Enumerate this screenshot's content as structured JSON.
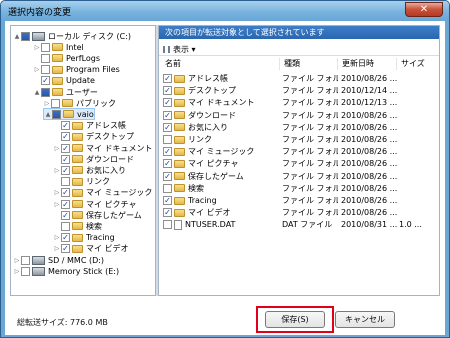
{
  "window": {
    "title": "選択内容の変更",
    "close_label": "✕"
  },
  "tree": {
    "items": [
      {
        "label": "ローカル ディスク (C:)",
        "kind": "drive",
        "checked": "partial",
        "arrow": "▲"
      },
      {
        "label": "Intel",
        "kind": "folder",
        "checked": false,
        "arrow": "▷"
      },
      {
        "label": "PerfLogs",
        "kind": "folder",
        "checked": false,
        "arrow": ""
      },
      {
        "label": "Program Files",
        "kind": "folder",
        "checked": false,
        "arrow": "▷"
      },
      {
        "label": "Update",
        "kind": "folder",
        "checked": true,
        "arrow": ""
      },
      {
        "label": "ユーザー",
        "kind": "folder",
        "checked": "partial",
        "arrow": "▲"
      },
      {
        "label": "パブリック",
        "kind": "folder",
        "checked": false,
        "arrow": "▷"
      },
      {
        "label": "vaio",
        "kind": "folder",
        "checked": "partial",
        "arrow": "▲"
      },
      {
        "label": "アドレス帳",
        "kind": "folder",
        "checked": true,
        "arrow": ""
      },
      {
        "label": "デスクトップ",
        "kind": "folder",
        "checked": true,
        "arrow": ""
      },
      {
        "label": "マイ ドキュメント",
        "kind": "folder",
        "checked": true,
        "arrow": "▷"
      },
      {
        "label": "ダウンロード",
        "kind": "folder",
        "checked": true,
        "arrow": ""
      },
      {
        "label": "お気に入り",
        "kind": "folder",
        "checked": true,
        "arrow": "▷"
      },
      {
        "label": "リンク",
        "kind": "folder",
        "checked": false,
        "arrow": ""
      },
      {
        "label": "マイ ミュージック",
        "kind": "folder",
        "checked": true,
        "arrow": "▷"
      },
      {
        "label": "マイ ピクチャ",
        "kind": "folder",
        "checked": true,
        "arrow": "▷"
      },
      {
        "label": "保存したゲーム",
        "kind": "folder",
        "checked": true,
        "arrow": ""
      },
      {
        "label": "検索",
        "kind": "folder",
        "checked": false,
        "arrow": ""
      },
      {
        "label": "Tracing",
        "kind": "folder",
        "checked": true,
        "arrow": "▷"
      },
      {
        "label": "マイ ビデオ",
        "kind": "folder",
        "checked": true,
        "arrow": "▷"
      },
      {
        "label": "SD / MMC (D:)",
        "kind": "drive",
        "checked": false,
        "arrow": "▷"
      },
      {
        "label": "Memory Stick (E:)",
        "kind": "drive",
        "checked": false,
        "arrow": "▷"
      }
    ]
  },
  "details": {
    "header": "次の項目が転送対象として選択されています",
    "view_label": "表示 ▾",
    "columns": {
      "name": "名前",
      "type": "種類",
      "date": "更新日時",
      "size": "サイズ"
    },
    "rows": [
      {
        "name": "アドレス帳",
        "type": "ファイル フォル...",
        "date": "2010/08/26 ...",
        "size": "",
        "checked": true,
        "icon": "folder"
      },
      {
        "name": "デスクトップ",
        "type": "ファイル フォル...",
        "date": "2010/12/14 ...",
        "size": "",
        "checked": true,
        "icon": "folder"
      },
      {
        "name": "マイ ドキュメント",
        "type": "ファイル フォル...",
        "date": "2010/12/13 ...",
        "size": "",
        "checked": true,
        "icon": "folder"
      },
      {
        "name": "ダウンロード",
        "type": "ファイル フォル...",
        "date": "2010/08/26 ...",
        "size": "",
        "checked": true,
        "icon": "folder"
      },
      {
        "name": "お気に入り",
        "type": "ファイル フォル...",
        "date": "2010/08/26 ...",
        "size": "",
        "checked": true,
        "icon": "folder"
      },
      {
        "name": "リンク",
        "type": "ファイル フォル...",
        "date": "2010/08/26 ...",
        "size": "",
        "checked": false,
        "icon": "folder"
      },
      {
        "name": "マイ ミュージック",
        "type": "ファイル フォル...",
        "date": "2010/08/26 ...",
        "size": "",
        "checked": true,
        "icon": "folder"
      },
      {
        "name": "マイ ピクチャ",
        "type": "ファイル フォル...",
        "date": "2010/08/26 ...",
        "size": "",
        "checked": true,
        "icon": "folder"
      },
      {
        "name": "保存したゲーム",
        "type": "ファイル フォル...",
        "date": "2010/08/26 ...",
        "size": "",
        "checked": true,
        "icon": "folder"
      },
      {
        "name": "検索",
        "type": "ファイル フォル...",
        "date": "2010/08/26 ...",
        "size": "",
        "checked": false,
        "icon": "folder"
      },
      {
        "name": "Tracing",
        "type": "ファイル フォル...",
        "date": "2010/08/26 ...",
        "size": "",
        "checked": true,
        "icon": "folder"
      },
      {
        "name": "マイ ビデオ",
        "type": "ファイル フォル...",
        "date": "2010/08/26 ...",
        "size": "",
        "checked": true,
        "icon": "folder"
      },
      {
        "name": "NTUSER.DAT",
        "type": "DAT ファイル",
        "date": "2010/08/31 ...",
        "size": "1.0 ...",
        "checked": false,
        "icon": "file"
      }
    ]
  },
  "footer": {
    "status": "総転送サイズ:  776.0 MB",
    "save_label": "保存(S)",
    "cancel_label": "キャンセル"
  },
  "colors": {
    "titlebar": "#78b3de",
    "header_bar": "#2a66b0",
    "selection": "#dcebfc",
    "highlight_outline": "#e0001b"
  }
}
